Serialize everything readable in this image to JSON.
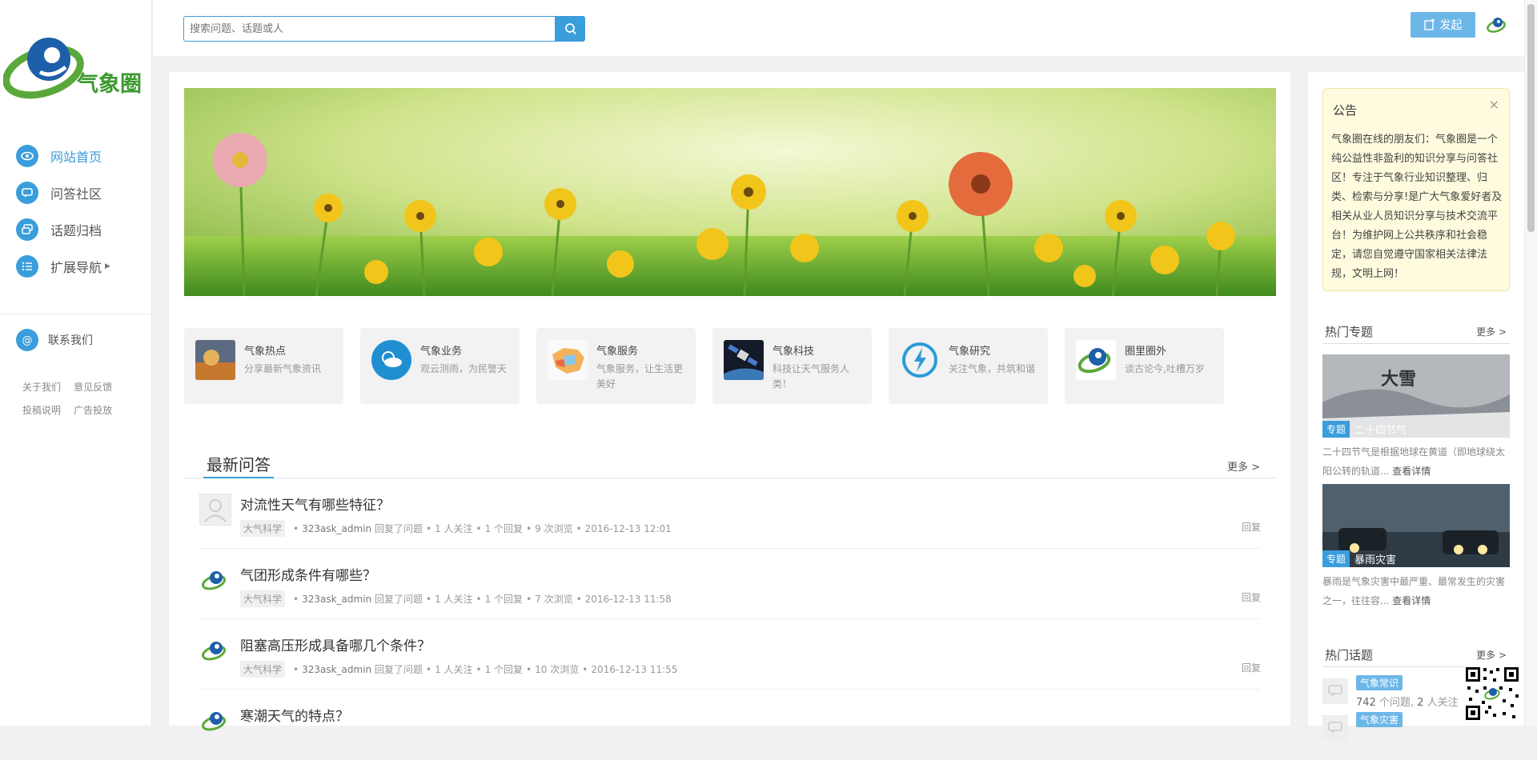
{
  "search": {
    "placeholder": "搜索问题、话题或人"
  },
  "header": {
    "publish_label": "发起"
  },
  "logo": {
    "text": "气象圈"
  },
  "sidebar": {
    "nav": [
      {
        "label": "网站首页"
      },
      {
        "label": "问答社区"
      },
      {
        "label": "话题归档"
      },
      {
        "label": "扩展导航"
      }
    ],
    "contact_label": "联系我们",
    "footer_links": [
      "关于我们",
      "意见反馈",
      "投稿说明",
      "广告投放"
    ]
  },
  "categories": [
    {
      "title": "气象热点",
      "desc": "分享最新气象资讯"
    },
    {
      "title": "气象业务",
      "desc": "观云测雨，为民警天"
    },
    {
      "title": "气象服务",
      "desc": "气象服务，让生活更美好"
    },
    {
      "title": "气象科技",
      "desc": "科技让天气服务人类！"
    },
    {
      "title": "气象研究",
      "desc": "关注气象，共筑和谐"
    },
    {
      "title": "圈里圈外",
      "desc": "谈古论今,吐槽万岁"
    }
  ],
  "qa": {
    "title": "最新问答",
    "more": "更多 >",
    "items": [
      {
        "question": "对流性天气有哪些特征？",
        "tag": "大气科学",
        "user": "323ask_admin",
        "action": "回复了问题",
        "follows": "1 人关注",
        "replies": "1 个回复",
        "views": "9 次浏览",
        "time": "2016-12-13 12:01",
        "reply": "回复"
      },
      {
        "question": "气团形成条件有哪些？",
        "tag": "大气科学",
        "user": "323ask_admin",
        "action": "回复了问题",
        "follows": "1 人关注",
        "replies": "1 个回复",
        "views": "7 次浏览",
        "time": "2016-12-13 11:58",
        "reply": "回复"
      },
      {
        "question": "阻塞高压形成具备哪几个条件？",
        "tag": "大气科学",
        "user": "323ask_admin",
        "action": "回复了问题",
        "follows": "1 人关注",
        "replies": "1 个回复",
        "views": "10 次浏览",
        "time": "2016-12-13 11:55",
        "reply": "回复"
      },
      {
        "question": "寒潮天气的特点？",
        "tag": "",
        "user": "",
        "action": "",
        "follows": "",
        "replies": "",
        "views": "",
        "time": "",
        "reply": ""
      }
    ]
  },
  "notice": {
    "title": "公告",
    "close": "×",
    "body": "气象圈在线的朋友们：气象圈是一个纯公益性非盈利的知识分享与问答社区！专注于气象行业知识整理、归类、检索与分享!是广大气象爱好者及相关从业人员知识分享与技术交流平台！为维护网上公共秩序和社会稳定，请您自觉遵守国家相关法律法规，文明上网！"
  },
  "hot_topics": {
    "title": "热门专题",
    "more": "更多 >",
    "items": [
      {
        "badge": "专题",
        "name": "二十四节气",
        "image_text": "大雪",
        "desc": "二十四节气是根据地球在黄道（即地球绕太阳公转的轨道...",
        "detail": "查看详情"
      },
      {
        "badge": "专题",
        "name": "暴雨灾害",
        "desc": "暴雨是气象灾害中最严重、最常发生的灾害之一，往往容...",
        "detail": "查看详情"
      }
    ]
  },
  "hot_subjects": {
    "title": "热门话题",
    "more": "更多 >",
    "items": [
      {
        "tag": "气象常识",
        "questions": "742",
        "q_unit": "个问题,",
        "follows": "2",
        "f_unit": "人关注"
      },
      {
        "tag": "气象灾害",
        "questions": "",
        "q_unit": "",
        "follows": "",
        "f_unit": ""
      }
    ]
  },
  "colors": {
    "accent": "#3a9ddc",
    "publish_button": "#6db7e8",
    "notice_bg": "#fffbde"
  }
}
